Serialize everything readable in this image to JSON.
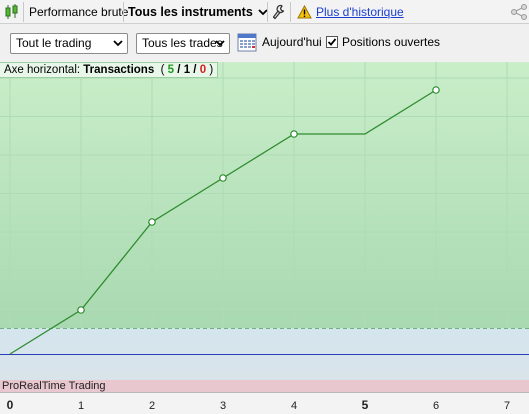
{
  "toolbar": {
    "performance_label": "Performance brute",
    "instruments_label": "Tous les instruments",
    "history_link": "Plus d'historique"
  },
  "filters": {
    "trading_select": "Tout le trading",
    "trades_select": "Tous les trades",
    "today_label": "Aujourd'hui",
    "open_positions_label": "Positions ouvertes",
    "open_positions_checked": true
  },
  "chart": {
    "axis_caption_prefix": "Axe horizontal:",
    "axis_caption_name": "Transactions",
    "count_open": "(",
    "count_total": "5",
    "count_sep1": "/",
    "count_win": "1",
    "count_sep2": "/",
    "count_loss": "0",
    "count_close": ")",
    "footer_label": "ProRealTime Trading",
    "colors": {
      "line": "#2f8b2f",
      "zero_line": "#2a3fb8",
      "win": "#1f9a1f",
      "loss": "#d02020"
    }
  },
  "chart_data": {
    "type": "line",
    "xlabel": "",
    "ylabel": "",
    "x_ticks": [
      "0",
      "1",
      "2",
      "3",
      "4",
      "5",
      "6",
      "7"
    ],
    "xlim": [
      0,
      7
    ],
    "series": [
      {
        "x": [
          0,
          1,
          2,
          3,
          4,
          5,
          6
        ],
        "y": [
          0,
          1,
          3,
          4,
          5,
          5,
          6
        ],
        "markers": [
          false,
          true,
          true,
          true,
          true,
          false,
          true
        ]
      }
    ],
    "grid": true
  }
}
